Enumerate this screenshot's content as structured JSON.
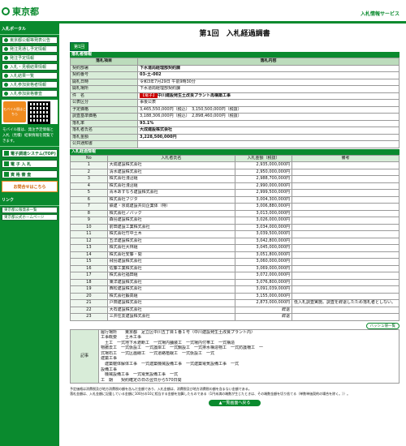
{
  "header": {
    "logo_text": "東京都",
    "service_title": "入札情報サービス"
  },
  "sidebar": {
    "heading": "入札ポータル",
    "menu": [
      "東京都公報等発表公告",
      "発注見通し予定情報",
      "発注予定情報",
      "入札・見積結果情報",
      "入札結果一覧",
      "入札参加資格者情報",
      "入札参加資格審査"
    ],
    "mobile_label": "モバイル版はこちら",
    "mobile_note": "モバイル版は、発注予定情報と入札（見積）結果情報を閲覧できます。",
    "buttons": [
      "電子調達システム(TOP)",
      "電 子 入 札",
      "資 格 審 査"
    ],
    "inquiry": "お問合せはこちら",
    "links_heading": "リンク",
    "links": [
      "東京都公報発表一覧",
      "東京都公式ホームページ"
    ]
  },
  "main": {
    "title": "第1回　入札経過調書",
    "tab": "第1回",
    "section_info": "落札者情報",
    "info_header": [
      "落札項目",
      "落札内容"
    ],
    "info_rows": [
      {
        "label": "契約部署",
        "value": "下水道局経理部契約課",
        "bold": true
      },
      {
        "label": "契約番号",
        "value": "03-土-002",
        "bold": true
      },
      {
        "label": "開札日時",
        "value": "令和3年7月29日 午前9時30分"
      },
      {
        "label": "開札場所",
        "value": "下水道局経理部契約課"
      },
      {
        "label": "件　名",
        "tag": "【電子】",
        "value": "中川建設発生土改良プラント再構築工事",
        "bold": true
      },
      {
        "label": "公表区分",
        "value": "事後公表"
      },
      {
        "label": "予定価格",
        "value": "3,465,550,000円（税込）　3,150,500,000円（税抜）"
      },
      {
        "label": "調査基準価格",
        "value": "3,188,306,000円（税込）　2,898,460,000円（税抜）"
      },
      {
        "label": "落札率",
        "value": "93.1%",
        "bold": true
      },
      {
        "label": "落札者氏名",
        "value": "大成建設株式会社",
        "bold": true
      },
      {
        "label": "落札金額",
        "value": "3,228,500,000円",
        "bold": true
      },
      {
        "label": "公共通知書",
        "value": ""
      }
    ],
    "section_bids": "入札経過情報",
    "bid_header": [
      "No",
      "入札者氏名",
      "入札金額（税抜）",
      "備考"
    ],
    "bids": [
      {
        "no": "1",
        "name": "大成建設株式会社",
        "amount": "2,935,000,000円",
        "note": ""
      },
      {
        "no": "2",
        "name": "清水建設株式会社",
        "amount": "2,950,000,000円",
        "note": ""
      },
      {
        "no": "3",
        "name": "株式会社淺沼組",
        "amount": "2,988,700,000円",
        "note": ""
      },
      {
        "no": "4",
        "name": "株式会社淺沼組",
        "amount": "2,990,000,000円",
        "note": ""
      },
      {
        "no": "5",
        "name": "青木あすなろ建設株式会社",
        "amount": "2,999,500,000円",
        "note": ""
      },
      {
        "no": "6",
        "name": "株式会社フジタ",
        "amount": "3,004,300,000円",
        "note": ""
      },
      {
        "no": "7",
        "name": "鉄建・京成建設共同企業体（特）",
        "amount": "3,006,880,000円",
        "note": ""
      },
      {
        "no": "8",
        "name": "株式会社ノバック",
        "amount": "3,013,000,000円",
        "note": ""
      },
      {
        "no": "9",
        "name": "森島建設株式会社",
        "amount": "3,026,000,000円",
        "note": ""
      },
      {
        "no": "10",
        "name": "前田建設工業株式会社",
        "amount": "3,034,000,000円",
        "note": ""
      },
      {
        "no": "11",
        "name": "株式会社竹中土木",
        "amount": "3,039,500,000円",
        "note": ""
      },
      {
        "no": "12",
        "name": "五洋建設株式会社",
        "amount": "3,042,800,000円",
        "note": ""
      },
      {
        "no": "13",
        "name": "株式会社大林組",
        "amount": "3,045,000,000円",
        "note": ""
      },
      {
        "no": "14",
        "name": "株式会社安藤・間",
        "amount": "3,051,800,000円",
        "note": ""
      },
      {
        "no": "15",
        "name": "飛島建設株式会社",
        "amount": "3,060,000,000円",
        "note": ""
      },
      {
        "no": "16",
        "name": "佐藤工業株式会社",
        "amount": "3,069,000,000円",
        "note": ""
      },
      {
        "no": "17",
        "name": "株式会社福田組",
        "amount": "3,072,000,000円",
        "note": ""
      },
      {
        "no": "18",
        "name": "東洋建設株式会社",
        "amount": "3,076,800,000円",
        "note": ""
      },
      {
        "no": "19",
        "name": "西松建設株式会社",
        "amount": "3,091,039,000円",
        "note": ""
      },
      {
        "no": "20",
        "name": "株式会社鍛高組",
        "amount": "3,155,000,000円",
        "note": ""
      },
      {
        "no": "21",
        "name": "戸田建設株式会社",
        "amount": "2,873,000,000円",
        "note": "低入札調査実施。調査を辞退したため落札者としない。"
      },
      {
        "no": "22",
        "name": "大石建設株式会社",
        "amount": "辞退",
        "note": ""
      },
      {
        "no": "23",
        "name": "三井住友建設株式会社",
        "amount": "辞退",
        "note": ""
      }
    ],
    "hash_button": "ハッシュ値一覧",
    "remark_label": "記事",
    "remark_lines": [
      "履行場所　　東京都　足立区中川五丁目１番１号（中川建設発生土改良プラント内）",
      "工事概要　　土木工事",
      "　土工　一式地下水遮断工　一式場内舗装工　一式場内付帯工　一式構造",
      "物撤去工　一式仮設工　一式護岸工　一式鋼設工　一式排水構造物工　一式防護柵工　一",
      "式場石工　一式区画線工　一式道路植栽工　一式仮設工　一式",
      "建築工事",
      "　建築躯体解体工事　一式建築機械設備工事　一式建築電気設備工事　一式",
      "設備工事",
      "　機械設備工事　一式電気設備工事　一式",
      "工　期　　契約確定の日の翌日から570日間"
    ],
    "footnotes": [
      "予定価格は消費税及び地方消費税の額を含んだ金額であり、入札金額は、消費税及び地方消費税の額を含まない金額である。",
      "落札金額は、入札金額に記載している金額に100分の10に相当する金額を加算したものである（1円未満の端数が生じたときは、その端数金額を切り捨てる（単数単価契約の場合を除く。））。"
    ],
    "back_button": "▲一覧画面へ戻る"
  }
}
